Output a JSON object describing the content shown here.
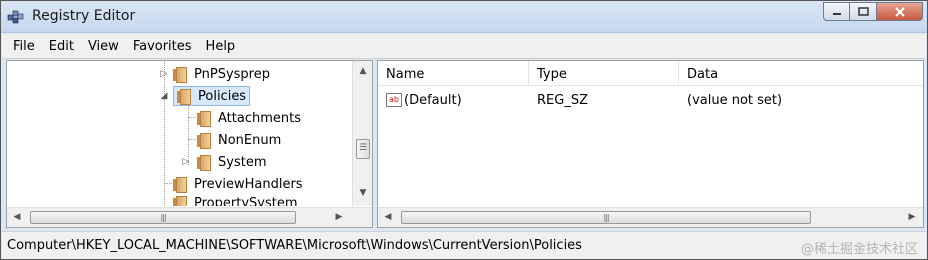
{
  "window": {
    "title": "Registry Editor"
  },
  "menu": [
    "File",
    "Edit",
    "View",
    "Favorites",
    "Help"
  ],
  "tree": {
    "items": [
      {
        "label": "PnPSysprep",
        "expander": "collapsed",
        "level": 0
      },
      {
        "label": "Policies",
        "expander": "expanded",
        "level": 0,
        "selected": true
      },
      {
        "label": "Attachments",
        "expander": "none",
        "level": 1
      },
      {
        "label": "NonEnum",
        "expander": "none",
        "level": 1
      },
      {
        "label": "System",
        "expander": "collapsed",
        "level": 1
      },
      {
        "label": "PreviewHandlers",
        "expander": "none",
        "level": 0
      },
      {
        "label": "PropertySystem",
        "expander": "none",
        "level": 0
      }
    ]
  },
  "list": {
    "columns": [
      "Name",
      "Type",
      "Data"
    ],
    "rows": [
      {
        "icon": "string-value-icon",
        "icon_text": "ab",
        "name": "(Default)",
        "type": "REG_SZ",
        "data": "(value not set)"
      }
    ]
  },
  "status": {
    "path": "Computer\\HKEY_LOCAL_MACHINE\\SOFTWARE\\Microsoft\\Windows\\CurrentVersion\\Policies",
    "watermark": "@稀土掘金技术社区"
  },
  "scroll": {
    "thumb_grip": "|||",
    "vgrip": "☰"
  },
  "colors": {
    "selection": "#d6e8fb",
    "titlebar": "#dae6f5",
    "close": "#c75a3e"
  }
}
